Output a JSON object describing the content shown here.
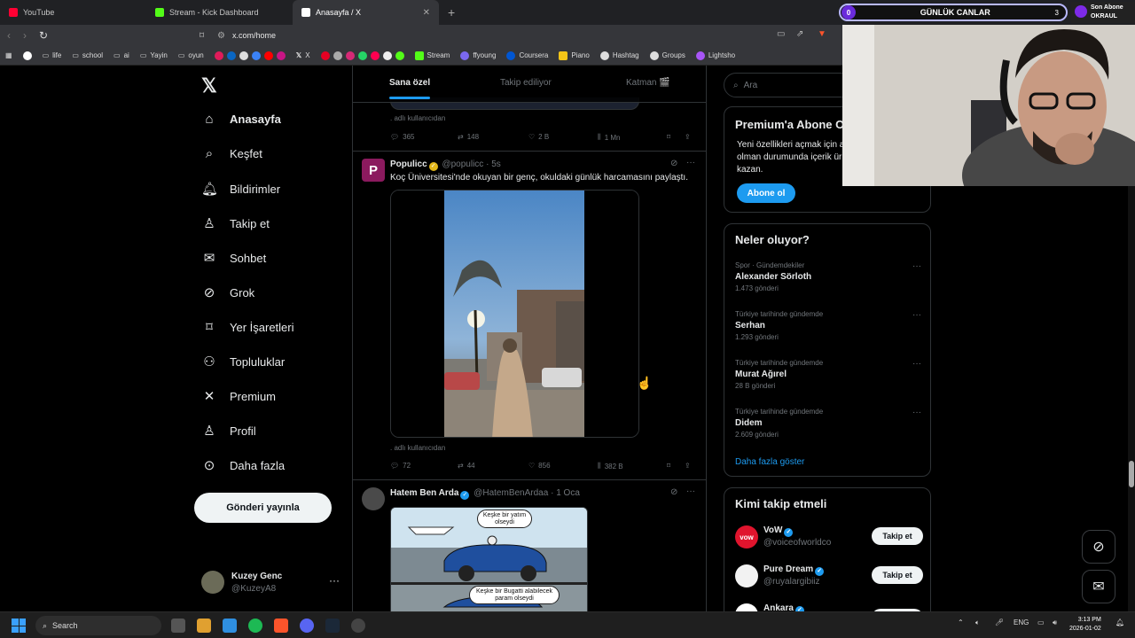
{
  "browser": {
    "tabs": [
      {
        "label": "YouTube",
        "color": "#ff0033"
      },
      {
        "label": "Stream - Kick Dashboard",
        "color": "#53fc18"
      },
      {
        "label": "Anasayfa / X",
        "color": "#ffffff"
      }
    ],
    "url": "x.com/home",
    "bookmarks": [
      "life",
      "school",
      "ai",
      "Yayin",
      "oyun",
      "X",
      "Stream",
      "ffyoung",
      "Coursera",
      "Piano",
      "Hashtag",
      "Groups",
      "Lightsho"
    ]
  },
  "overlay": {
    "counter_left": "0",
    "title": "GÜNLÜK CANLAR",
    "counter_right": "3",
    "last_sub_title": "Son Abone",
    "last_sub_name": "OKRAUL"
  },
  "sidebar": {
    "logo": "X",
    "items": [
      {
        "label": "Anasayfa",
        "icon": "home-icon",
        "glyph": "⌂"
      },
      {
        "label": "Keşfet",
        "icon": "search-icon",
        "glyph": "⌕"
      },
      {
        "label": "Bildirimler",
        "icon": "bell-icon",
        "glyph": "♫"
      },
      {
        "label": "Takip et",
        "icon": "add-user-icon",
        "glyph": "♙"
      },
      {
        "label": "Sohbet",
        "icon": "mail-icon",
        "glyph": "✉"
      },
      {
        "label": "Grok",
        "icon": "grok-icon",
        "glyph": "⊘"
      },
      {
        "label": "Yer İşaretleri",
        "icon": "bookmark-icon",
        "glyph": "⌑"
      },
      {
        "label": "Topluluklar",
        "icon": "communities-icon",
        "glyph": "⚇"
      },
      {
        "label": "Premium",
        "icon": "x-premium-icon",
        "glyph": "✕"
      },
      {
        "label": "Profil",
        "icon": "profile-icon",
        "glyph": "♙"
      },
      {
        "label": "Daha fazla",
        "icon": "more-circle-icon",
        "glyph": "⊙"
      }
    ],
    "post_button": "Gönderi yayınla",
    "user": {
      "name": "Kuzey Genc",
      "handle": "@KuzeyA8"
    }
  },
  "feed": {
    "tabs": [
      "Sana özel",
      "Takip ediliyor",
      "Katman 🎬"
    ],
    "posts": [
      {
        "note": ". adlı kullanıcıdan",
        "stats": {
          "replies": "365",
          "reposts": "148",
          "likes": "2 B",
          "views": "1 Mn"
        }
      },
      {
        "name": "Populicc",
        "handle": "@populicc",
        "time": "5s",
        "avatar_letter": "P",
        "text": "Koç Üniversitesi'nde okuyan bir genç, okuldaki günlük harcamasını paylaştı.",
        "note": ". adlı kullanıcıdan",
        "stats": {
          "replies": "72",
          "reposts": "44",
          "likes": "856",
          "views": "382 B"
        }
      },
      {
        "name": "Hatem Ben Arda",
        "handle": "@HatemBenArdaa",
        "time": "1 Oca",
        "bubble1": "Keşke bir yatım olseydi",
        "bubble2": "Keşke bir Bugatti alabilecek param olseydi"
      }
    ]
  },
  "right": {
    "search_placeholder": "Ara",
    "premium": {
      "title": "Premium'a Abone O",
      "text1": "Yeni özellikleri açmak için a",
      "text2": "olman durumunda içerik ür",
      "text3": "kazan.",
      "button": "Abone ol"
    },
    "trends_title": "Neler oluyor?",
    "trends": [
      {
        "context": "Spor · Gündemdekiler",
        "name": "Alexander Sörloth",
        "count": "1.473 gönderi"
      },
      {
        "context": "Türkiye tarihinde gündemde",
        "name": "Serhan",
        "count": "1.293 gönderi"
      },
      {
        "context": "Türkiye tarihinde gündemde",
        "name": "Murat Ağırel",
        "count": "28 B gönderi"
      },
      {
        "context": "Türkiye tarihinde gündemde",
        "name": "Didem",
        "count": "2.609 gönderi"
      }
    ],
    "show_more": "Daha fazla göster",
    "who_title": "Kimi takip etmeli",
    "who": [
      {
        "name": "VoW",
        "handle": "@voiceofworldco",
        "button": "Takip et",
        "color": "#e0142d"
      },
      {
        "name": "Pure Dream",
        "handle": "@ruyalargibiiz",
        "button": "Takip et",
        "color": "#f2f2f2"
      },
      {
        "name": "Ankara",
        "handle": "",
        "button": "",
        "color": "#ffffff"
      }
    ]
  },
  "taskbar": {
    "search": "Search",
    "lang": "ENG",
    "time": "3:13 PM",
    "date": "2026-01-02"
  },
  "colors": {
    "accent": "#1d9bf0",
    "background": "#000000",
    "border": "#2f3336",
    "muted": "#71767b"
  }
}
